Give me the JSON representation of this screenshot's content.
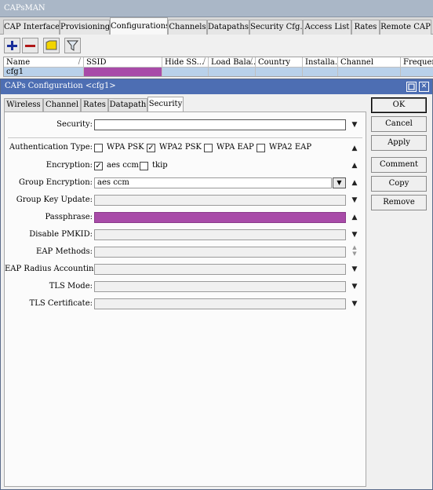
{
  "window": {
    "title": "CAPsMAN"
  },
  "main_tabs": [
    {
      "label": "CAP Interface"
    },
    {
      "label": "Provisioning"
    },
    {
      "label": "Configurations"
    },
    {
      "label": "Channels"
    },
    {
      "label": "Datapaths"
    },
    {
      "label": "Security Cfg."
    },
    {
      "label": "Access List"
    },
    {
      "label": "Rates"
    },
    {
      "label": "Remote CAP"
    }
  ],
  "active_main_tab": "Configurations",
  "grid": {
    "columns": [
      "Name",
      "SSID",
      "Hide SS...",
      "Load Bala...",
      "Country",
      "Installa...",
      "Channel",
      "Frequenc"
    ],
    "rows": [
      [
        "cfg1",
        "",
        "",
        "",
        "",
        "",
        "",
        ""
      ]
    ]
  },
  "dialog": {
    "title": "CAPs Configuration <cfg1>",
    "tabs": [
      {
        "label": "Wireless"
      },
      {
        "label": "Channel"
      },
      {
        "label": "Rates"
      },
      {
        "label": "Datapath"
      },
      {
        "label": "Security"
      }
    ],
    "active_tab": "Security",
    "fields": {
      "security": {
        "label": "Security:",
        "value": ""
      },
      "auth_type": {
        "label": "Authentication Type:",
        "options": [
          {
            "label": "WPA PSK",
            "checked": false
          },
          {
            "label": "WPA2 PSK",
            "checked": true
          },
          {
            "label": "WPA EAP",
            "checked": false
          },
          {
            "label": "WPA2 EAP",
            "checked": false
          }
        ]
      },
      "encryption": {
        "label": "Encryption:",
        "options": [
          {
            "label": "aes ccm",
            "checked": true
          },
          {
            "label": "tkip",
            "checked": false
          }
        ]
      },
      "group_encryption": {
        "label": "Group Encryption:",
        "value": "aes ccm"
      },
      "group_key_update": {
        "label": "Group Key Update:",
        "value": ""
      },
      "passphrase": {
        "label": "Passphrase:",
        "value": ""
      },
      "disable_pmkid": {
        "label": "Disable PMKID:",
        "value": ""
      },
      "eap_methods": {
        "label": "EAP Methods:",
        "value": ""
      },
      "eap_radius_accounting": {
        "label": "EAP Radius Accounting:",
        "value": ""
      },
      "tls_mode": {
        "label": "TLS Mode:",
        "value": ""
      },
      "tls_certificate": {
        "label": "TLS Certificate:",
        "value": ""
      }
    },
    "buttons": {
      "ok": "OK",
      "cancel": "Cancel",
      "apply": "Apply",
      "comment": "Comment",
      "copy": "Copy",
      "remove": "Remove"
    }
  },
  "colors": {
    "selected_row": "#b9d1ea",
    "ssid_highlight": "#a84ba8",
    "dialog_title": "#4d6eb3",
    "outer_title": "#aab7c7"
  }
}
